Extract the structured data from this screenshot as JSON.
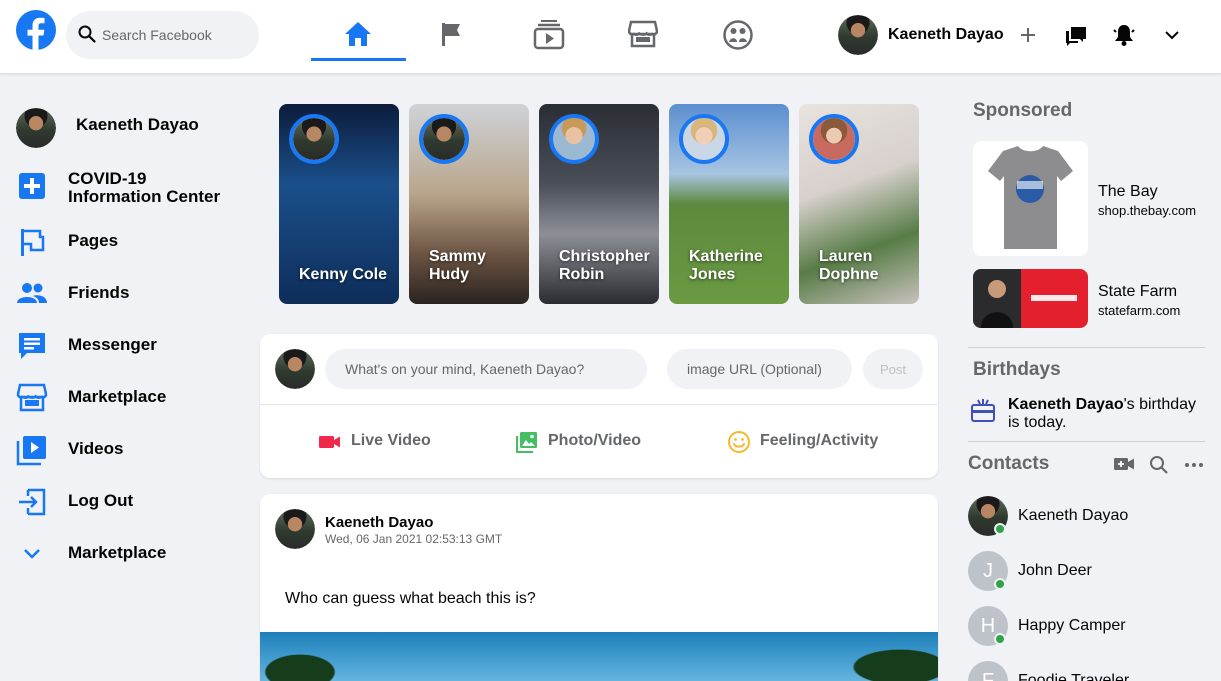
{
  "header": {
    "search_placeholder": "Search Facebook",
    "user_name": "Kaeneth Dayao",
    "nav_tabs": [
      "home",
      "pages",
      "watch",
      "marketplace",
      "groups"
    ],
    "accent_color": "#1877f2"
  },
  "left_sidebar": {
    "profile_name": "Kaeneth Dayao",
    "items": [
      {
        "label": "COVID-19 Information Center",
        "icon": "plus-square-icon"
      },
      {
        "label": "Pages",
        "icon": "flag-icon"
      },
      {
        "label": "Friends",
        "icon": "friends-icon"
      },
      {
        "label": "Messenger",
        "icon": "messenger-icon"
      },
      {
        "label": "Marketplace",
        "icon": "store-icon"
      },
      {
        "label": "Videos",
        "icon": "video-icon"
      },
      {
        "label": "Log Out",
        "icon": "logout-icon"
      },
      {
        "label": "Marketplace",
        "icon": "chevron-down-icon"
      }
    ]
  },
  "stories": [
    {
      "name": "Kenny Cole"
    },
    {
      "name": "Sammy Hudy"
    },
    {
      "name": "Christopher Robin"
    },
    {
      "name": "Katherine Jones"
    },
    {
      "name": "Lauren Dophne"
    }
  ],
  "composer": {
    "placeholder": "What's on your mind, Kaeneth Dayao?",
    "url_placeholder": "image URL (Optional)",
    "post_label": "Post",
    "actions": [
      {
        "label": "Live Video",
        "color": "#f02849"
      },
      {
        "label": "Photo/Video",
        "color": "#45bd62"
      },
      {
        "label": "Feeling/Activity",
        "color": "#f7b928"
      }
    ]
  },
  "post": {
    "author": "Kaeneth Dayao",
    "timestamp": "Wed, 06 Jan 2021 02:53:13 GMT",
    "text": "Who can guess what beach this is?"
  },
  "right_sidebar": {
    "sponsored_heading": "Sponsored",
    "ads": [
      {
        "name": "The Bay",
        "url": "shop.thebay.com"
      },
      {
        "name": "State Farm",
        "url": "statefarm.com"
      }
    ],
    "birthdays_heading": "Birthdays",
    "birthday_name": "Kaeneth Dayao",
    "birthday_suffix": "'s birthday is today.",
    "contacts_heading": "Contacts",
    "contacts": [
      {
        "name": "Kaeneth Dayao",
        "initial": ""
      },
      {
        "name": "John Deer",
        "initial": "J"
      },
      {
        "name": "Happy Camper",
        "initial": "H"
      },
      {
        "name": "Foodie Traveler",
        "initial": "F"
      }
    ],
    "online_color": "#31a24c"
  }
}
